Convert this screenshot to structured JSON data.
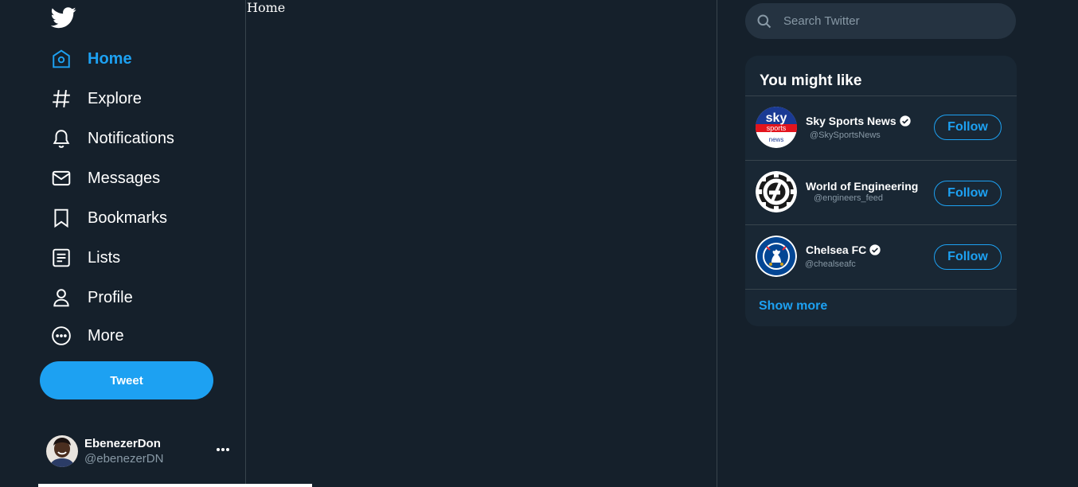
{
  "sidebar": {
    "logo": "twitter-bird-icon",
    "nav": [
      {
        "label": "Home",
        "icon": "home-icon",
        "active": true
      },
      {
        "label": "Explore",
        "icon": "hashtag-icon"
      },
      {
        "label": "Notifications",
        "icon": "bell-icon"
      },
      {
        "label": "Messages",
        "icon": "envelope-icon"
      },
      {
        "label": "Bookmarks",
        "icon": "bookmark-icon"
      },
      {
        "label": "Lists",
        "icon": "list-icon"
      },
      {
        "label": "Profile",
        "icon": "person-icon"
      },
      {
        "label": "More",
        "icon": "more-circle-icon"
      }
    ],
    "tweet_label": "Tweet",
    "account": {
      "name": "EbenezerDon",
      "handle": "@ebenezerDN"
    }
  },
  "main": {
    "title": "Home"
  },
  "search": {
    "placeholder": "Search Twitter"
  },
  "suggestions": {
    "title": "You might like",
    "items": [
      {
        "name": "Sky Sports News",
        "handle": "@SkySportsNews",
        "verified": true,
        "follow_label": "Follow"
      },
      {
        "name": "World of Engineering",
        "handle": "@engineers_feed",
        "verified": false,
        "follow_label": "Follow"
      },
      {
        "name": "Chelsea FC",
        "handle": "@chealseafc",
        "verified": true,
        "follow_label": "Follow"
      }
    ],
    "show_more": "Show more"
  },
  "colors": {
    "background": "#15202b",
    "accent": "#1da1f2",
    "card": "#192734",
    "muted": "#8899a6"
  }
}
